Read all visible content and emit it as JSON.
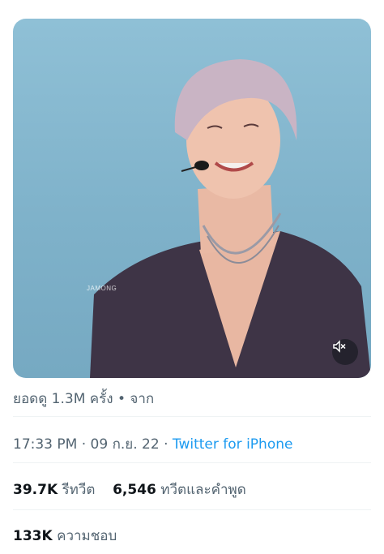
{
  "media": {
    "watermark": "JAMONG",
    "mute_icon": "speaker-muted-icon"
  },
  "tweet_meta": {
    "views_text": "ยอดดู 1.3M ครั้ง • จาก",
    "time": "17:33 PM",
    "sep1": " · ",
    "date": "09 ก.ย. 22",
    "sep2": " · ",
    "source": "Twitter for iPhone"
  },
  "stats": {
    "retweets_count": "39.7K",
    "retweets_label": "รีทวีต",
    "quotes_count": "6,546",
    "quotes_label": "ทวีตและคำพูด",
    "likes_count": "133K",
    "likes_label": "ความชอบ"
  },
  "colors": {
    "link": "#1d9bf0",
    "secondary_text": "#536471",
    "primary_text": "#0f1419"
  }
}
